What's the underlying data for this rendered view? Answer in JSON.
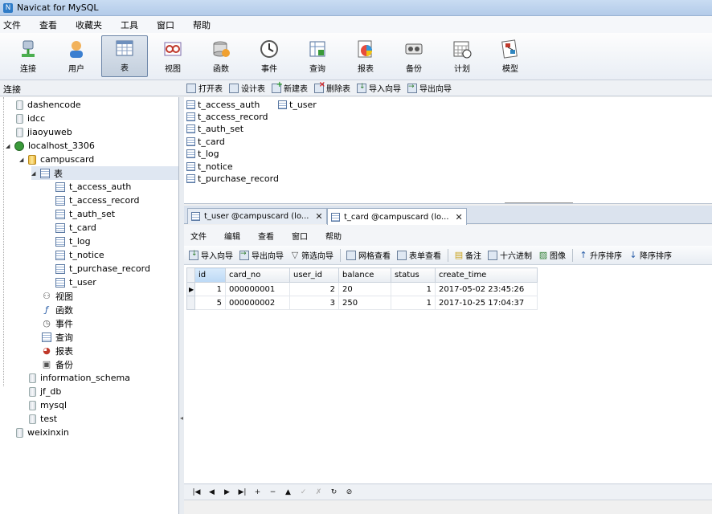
{
  "window": {
    "title": "Navicat for MySQL"
  },
  "menubar": [
    "文件",
    "查看",
    "收藏夹",
    "工具",
    "窗口",
    "帮助"
  ],
  "toolbar": [
    {
      "label": "连接",
      "icon": "connection-icon"
    },
    {
      "label": "用户",
      "icon": "user-icon"
    },
    {
      "label": "表",
      "icon": "table-icon",
      "active": true
    },
    {
      "label": "视图",
      "icon": "view-icon"
    },
    {
      "label": "函数",
      "icon": "function-icon"
    },
    {
      "label": "事件",
      "icon": "event-icon"
    },
    {
      "label": "查询",
      "icon": "query-icon"
    },
    {
      "label": "报表",
      "icon": "report-icon"
    },
    {
      "label": "备份",
      "icon": "backup-icon"
    },
    {
      "label": "计划",
      "icon": "schedule-icon"
    },
    {
      "label": "模型",
      "icon": "model-icon"
    }
  ],
  "subbar": {
    "connection_label": "连接"
  },
  "object_actions": [
    "打开表",
    "设计表",
    "新建表",
    "删除表",
    "导入向导",
    "导出向导"
  ],
  "tree": [
    {
      "label": "dashencode",
      "type": "db"
    },
    {
      "label": "idcc",
      "type": "db"
    },
    {
      "label": "jiaoyuweb",
      "type": "db"
    },
    {
      "label": "localhost_3306",
      "type": "host"
    },
    {
      "label": "campuscard",
      "type": "db-open"
    },
    {
      "label": "表",
      "type": "table-folder"
    },
    {
      "label": "t_access_auth",
      "type": "table"
    },
    {
      "label": "t_access_record",
      "type": "table"
    },
    {
      "label": "t_auth_set",
      "type": "table"
    },
    {
      "label": "t_card",
      "type": "table"
    },
    {
      "label": "t_log",
      "type": "table"
    },
    {
      "label": "t_notice",
      "type": "table"
    },
    {
      "label": "t_purchase_record",
      "type": "table"
    },
    {
      "label": "t_user",
      "type": "table"
    },
    {
      "label": "视图",
      "type": "view"
    },
    {
      "label": "函数",
      "type": "function"
    },
    {
      "label": "事件",
      "type": "event"
    },
    {
      "label": "查询",
      "type": "query"
    },
    {
      "label": "报表",
      "type": "report"
    },
    {
      "label": "备份",
      "type": "backup"
    },
    {
      "label": "information_schema",
      "type": "db"
    },
    {
      "label": "jf_db",
      "type": "db"
    },
    {
      "label": "mysql",
      "type": "db"
    },
    {
      "label": "test",
      "type": "db"
    },
    {
      "label": "weixinxin",
      "type": "db"
    }
  ],
  "object_list": {
    "col1": [
      "t_access_auth",
      "t_access_record",
      "t_auth_set",
      "t_card",
      "t_log",
      "t_notice",
      "t_purchase_record"
    ],
    "col2": [
      "t_user"
    ]
  },
  "doc_tabs": [
    {
      "label": "t_user @campuscard (lo...",
      "active": false
    },
    {
      "label": "t_card @campuscard (lo...",
      "active": true
    }
  ],
  "doc_menu": [
    "文件",
    "编辑",
    "查看",
    "窗口",
    "帮助"
  ],
  "doc_toolbar": [
    "导入向导",
    "导出向导",
    "筛选向导",
    "网格查看",
    "表单查看",
    "备注",
    "十六进制",
    "图像",
    "升序排序",
    "降序排序"
  ],
  "grid": {
    "columns": [
      "id",
      "card_no",
      "user_id",
      "balance",
      "status",
      "create_time"
    ],
    "rows": [
      [
        "1",
        "000000001",
        "2",
        "20",
        "1",
        "2017-05-02 23:45:26"
      ],
      [
        "5",
        "000000002",
        "3",
        "250",
        "1",
        "2017-10-25 17:04:37"
      ]
    ]
  },
  "nav_buttons": [
    "|◀",
    "◀",
    "▶",
    "▶|",
    "+",
    "−",
    "▲",
    "✓",
    "✗",
    "↻",
    "⊘"
  ]
}
